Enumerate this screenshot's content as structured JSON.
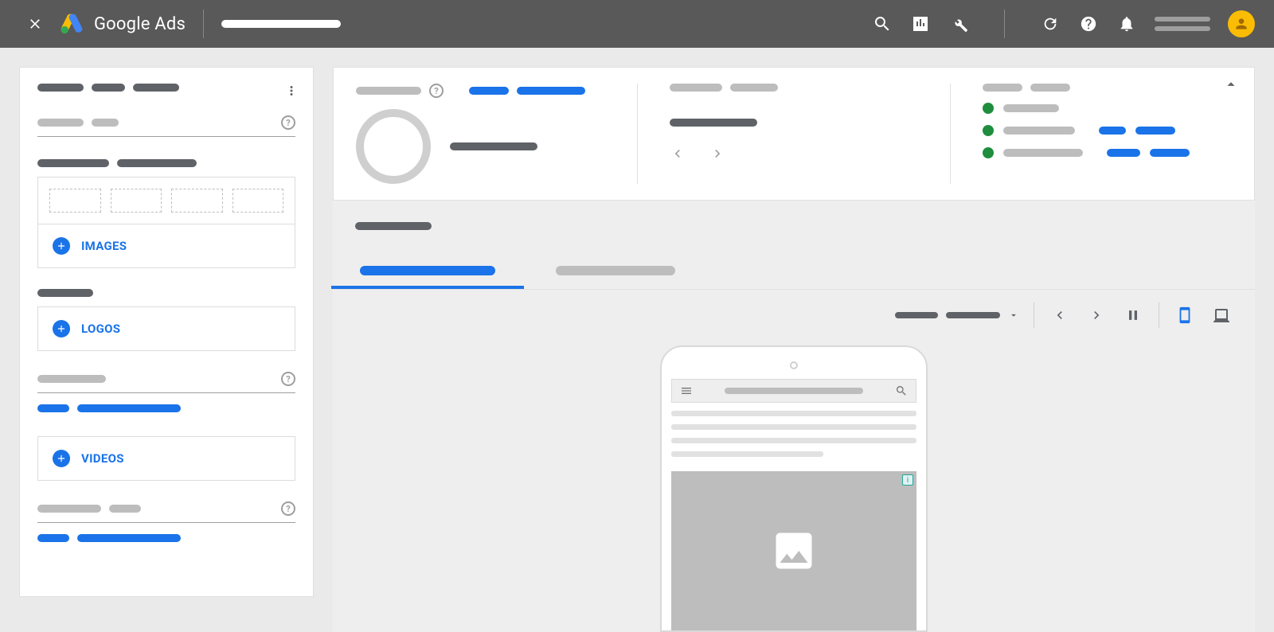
{
  "header": {
    "product_name": "Google Ads",
    "icons": {
      "close": "close-icon",
      "search": "search-icon",
      "reports": "reports-icon",
      "tools": "tools-icon",
      "refresh": "refresh-icon",
      "help": "help-icon",
      "notifications": "notifications-icon",
      "account": "account-avatar"
    }
  },
  "sidepanel": {
    "assets": {
      "images_label": "IMAGES",
      "logos_label": "LOGOS",
      "videos_label": "VIDEOS"
    }
  },
  "summary": {
    "status_items": [
      "ok",
      "ok",
      "ok"
    ]
  },
  "preview": {
    "devices": {
      "mobile_active": true
    }
  },
  "colors": {
    "accent": "#1a73e8",
    "success": "#1e8e3e",
    "avatar": "#fbbc04"
  }
}
